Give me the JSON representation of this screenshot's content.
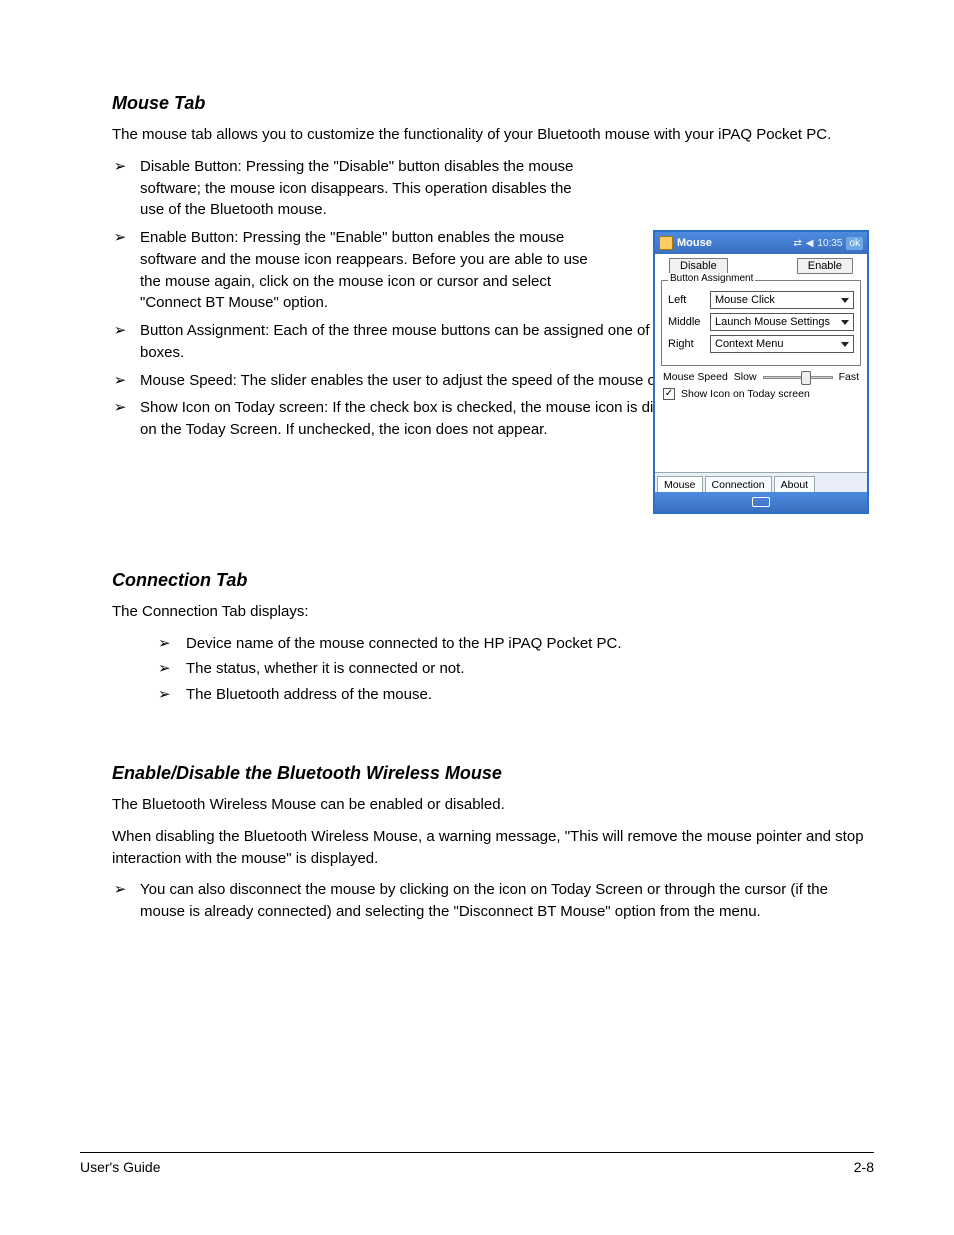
{
  "section1": {
    "heading": "Mouse Tab",
    "lead": "The mouse tab allows you to customize the functionality of your Bluetooth mouse with your iPAQ Pocket PC.",
    "bullets": [
      "Disable Button: Pressing the \"Disable\" button disables the mouse software; the mouse icon disappears.  This operation disables the use of the Bluetooth mouse.",
      "Enable Button: Pressing the \"Enable\" button enables the mouse software and the mouse icon reappears.  Before you are able to use the mouse again, click on the mouse icon or cursor and select \"Connect BT Mouse\" option.",
      "Button Assignment: Each of the three mouse buttons can be assigned one of the functions from the given list boxes.",
      "Mouse Speed: The slider enables the user to adjust the speed of the mouse cursor movement.",
      "Show Icon on Today screen: If the check box is checked, the mouse icon is displayed in the lower right corner on the Today Screen.  If unchecked, the icon does not appear."
    ]
  },
  "section2": {
    "heading": "Connection Tab",
    "lead": "The Connection Tab displays:",
    "items": [
      "Device name of the mouse connected to the HP iPAQ Pocket PC.",
      "The status, whether it is connected or not.",
      "The Bluetooth address of the mouse."
    ]
  },
  "section3": {
    "heading": "Enable/Disable the Bluetooth Wireless Mouse",
    "lead": "The Bluetooth Wireless Mouse can be enabled or disabled.",
    "body": "When disabling the Bluetooth Wireless Mouse, a warning message, \"This will remove the mouse pointer and stop interaction with the mouse\" is displayed.",
    "bullets": [
      "You can also disconnect the mouse by clicking on the icon on Today Screen or through the cursor (if the mouse is already connected) and selecting the \"Disconnect BT Mouse\" option from the menu."
    ]
  },
  "device": {
    "title": "Mouse",
    "time": "10:35",
    "ok": "ok",
    "buttons": {
      "disable": "Disable",
      "enable": "Enable"
    },
    "group": "Button Assignment",
    "labels": {
      "left": "Left",
      "middle": "Middle",
      "right": "Right"
    },
    "assign": {
      "left": "Mouse Click",
      "middle": "Launch Mouse Settings",
      "right": "Context Menu"
    },
    "speed": {
      "label": "Mouse Speed",
      "slow": "Slow",
      "fast": "Fast"
    },
    "checkbox": "Show Icon on Today screen",
    "tabs": [
      "Mouse",
      "Connection",
      "About"
    ]
  },
  "footer": {
    "left": "User's Guide",
    "right": "2-8"
  }
}
